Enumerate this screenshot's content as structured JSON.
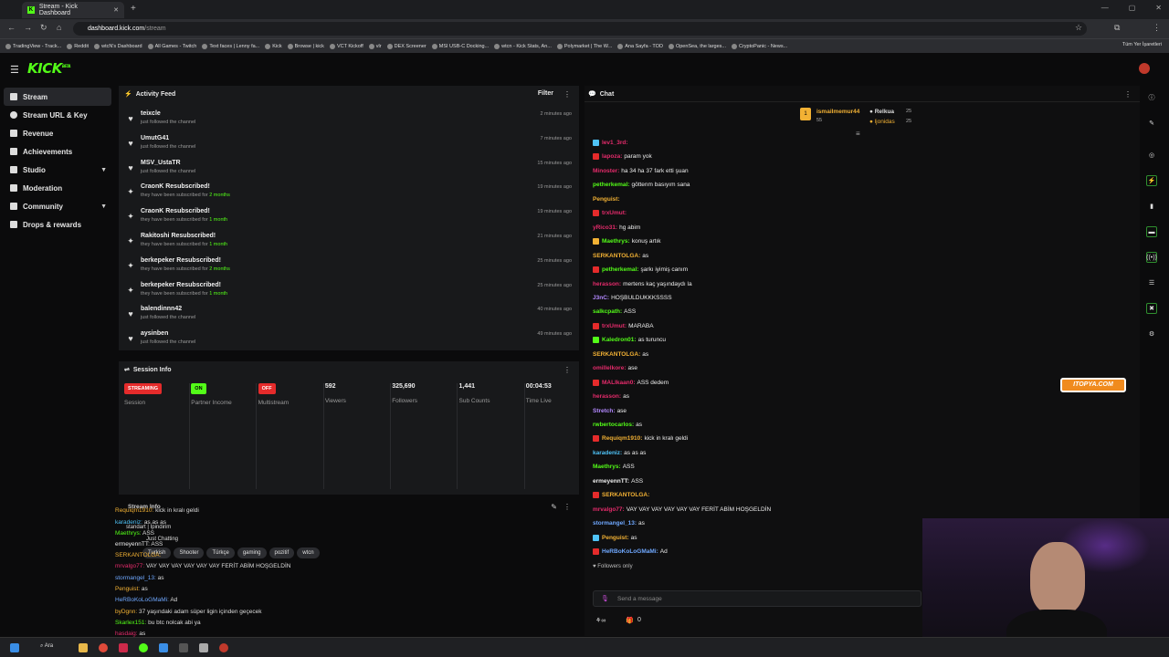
{
  "browser": {
    "tab_title": "Stream - Kick Dashboard",
    "url_host": "dashboard.kick.com",
    "url_path": "/stream",
    "bookmarks": [
      "TradingView - Track...",
      "Reddit",
      "wtcN's Dashboard",
      "All Games - Twitch",
      "Text faces | Lenny fa...",
      "Kick",
      "Browse | kick",
      "VCT Kickoff",
      "vlr",
      "DEX Screener",
      "MSI USB-C Docking...",
      "wtcn - Kick Stats, An...",
      "Polymarket | The W...",
      "Ana Sayfa - TOD",
      "OpenSea, the larges...",
      "CryptoPanic - News..."
    ],
    "all_bookmarks": "Tüm Yer İşaretleri"
  },
  "logo": "KICK",
  "logo_sup": "BETA",
  "sidebar": {
    "items": [
      {
        "label": "Stream"
      },
      {
        "label": "Stream URL & Key"
      },
      {
        "label": "Revenue"
      },
      {
        "label": "Achievements"
      },
      {
        "label": "Studio"
      },
      {
        "label": "Moderation"
      },
      {
        "label": "Community"
      },
      {
        "label": "Drops & rewards"
      }
    ]
  },
  "activity": {
    "title": "Activity Feed",
    "filter": "Filter",
    "items": [
      {
        "name": "teixcle",
        "sub": "just followed the channel",
        "time": "2 minutes ago"
      },
      {
        "name": "UmutG41",
        "sub": "just followed the channel",
        "time": "7 minutes ago"
      },
      {
        "name": "MSV_UstaTR",
        "sub": "just followed the channel",
        "time": "15 minutes ago"
      },
      {
        "name": "CraonK Resubscribed!",
        "sub": "they have been subscribed for",
        "dur": "2 months",
        "time": "19 minutes ago"
      },
      {
        "name": "CraonK Resubscribed!",
        "sub": "they have been subscribed for",
        "dur": "1 month",
        "time": "19 minutes ago"
      },
      {
        "name": "Rakitoshi Resubscribed!",
        "sub": "they have been subscribed for",
        "dur": "1 month",
        "time": "21 minutes ago"
      },
      {
        "name": "berkepeker Resubscribed!",
        "sub": "they have been subscribed for",
        "dur": "2 months",
        "time": "25 minutes ago"
      },
      {
        "name": "berkepeker Resubscribed!",
        "sub": "they have been subscribed for",
        "dur": "1 month",
        "time": "25 minutes ago"
      },
      {
        "name": "balendinnn42",
        "sub": "just followed the channel",
        "time": "40 minutes ago"
      },
      {
        "name": "aysinben",
        "sub": "just followed the channel",
        "time": "49 minutes ago"
      }
    ]
  },
  "session": {
    "title": "Session Info",
    "cols": [
      {
        "badge": "STREAMING",
        "badge_color": "#e52b2b",
        "label": "Session"
      },
      {
        "badge": "ON",
        "badge_color": "#53fc18",
        "label": "Partner Income"
      },
      {
        "badge": "OFF",
        "badge_color": "#e52b2b",
        "label": "Multistream"
      },
      {
        "value": "592",
        "label": "Viewers"
      },
      {
        "value": "325,690",
        "label": "Followers"
      },
      {
        "value": "1,441",
        "label": "Sub Counts"
      },
      {
        "value": "00:04:53",
        "label": "Time Live"
      }
    ]
  },
  "stream_info": {
    "title": "Stream Info",
    "stream_title": "standart | İpindirim",
    "category": "Just Chatting",
    "tags": [
      "Turkish",
      "Shooter",
      "Türkçe",
      "gaming",
      "pozitif",
      "wtcn"
    ]
  },
  "overlay_chat": [
    {
      "user": "Requiqm1910:",
      "msg": "kick in kralı geldi",
      "color": "#f2b134"
    },
    {
      "user": "karadeniz:",
      "msg": "as as as",
      "color": "#4fc3f7"
    },
    {
      "user": "Maethrys:",
      "msg": "ASS",
      "color": "#53fc18"
    },
    {
      "user": "ermeyennTT:",
      "msg": "ASS",
      "color": "#eee"
    },
    {
      "user": "SERKANTOLGA:",
      "msg": "",
      "color": "#f2b134"
    },
    {
      "user": "mrvalgo77:",
      "msg": "VAY VAY VAY VAY VAY VAY FERİT ABİM HOŞGELDİN",
      "color": "#e52b6b"
    },
    {
      "user": "stormangel_13:",
      "msg": "as",
      "color": "#6fa8ff"
    },
    {
      "user": "Penguist:",
      "msg": "as",
      "color": "#f2b134"
    },
    {
      "user": "HeRBoKoLoGMaMi:",
      "msg": "Ad",
      "color": "#6fa8ff"
    },
    {
      "user": "byDgnn:",
      "msg": "37 yaşındaki adam süper ligin içinden geçecek",
      "color": "#f2b134"
    },
    {
      "user": "Skarlex151:",
      "msg": "bu btc nolcak abi ya",
      "color": "#53fc18"
    },
    {
      "user": "hasdaig:",
      "msg": "as",
      "color": "#e52b6b"
    }
  ],
  "chat": {
    "title": "Chat",
    "top_gifters": [
      {
        "name": "ismailmemur44",
        "count": "55"
      },
      {
        "name": "Relkua",
        "count": "25"
      },
      {
        "name": "ljonidas",
        "count": "25"
      }
    ],
    "messages": [
      {
        "user": "lev1_3rd:",
        "msg": "",
        "color": "#e52b6b"
      },
      {
        "user": "lapoza:",
        "msg": "param yok",
        "color": "#e52b6b"
      },
      {
        "user": "Minoster:",
        "msg": "ha 34 ha 37 fark etti şuan",
        "color": "#e52b6b"
      },
      {
        "user": "petherkemal:",
        "msg": "göttenm basıyım sana",
        "color": "#53fc18"
      },
      {
        "user": "Penguist:",
        "msg": "",
        "color": "#f2b134"
      },
      {
        "user": "trxUmut:",
        "msg": "",
        "color": "#e52b6b"
      },
      {
        "user": "yRico31:",
        "msg": "hg abim",
        "color": "#e52b6b"
      },
      {
        "user": "Maethrys:",
        "msg": "konuş artık",
        "color": "#53fc18"
      },
      {
        "user": "SERKANTOLGA:",
        "msg": "as",
        "color": "#f2b134"
      },
      {
        "user": "petherkemal:",
        "msg": "şarkı iyimiş canım",
        "color": "#53fc18"
      },
      {
        "user": "herasson:",
        "msg": "mertens kaç yaşındaydı la",
        "color": "#e52b6b"
      },
      {
        "user": "J3nC:",
        "msg": "HOŞBULDUKKKSSSS",
        "color": "#b388ff"
      },
      {
        "user": "salkcpath:",
        "msg": "ASS",
        "color": "#53fc18"
      },
      {
        "user": "trxUmut:",
        "msg": "MARABA",
        "color": "#e52b6b"
      },
      {
        "user": "Kaledron01:",
        "msg": "as turuncu",
        "color": "#53fc18"
      },
      {
        "user": "SERKANTOLGA:",
        "msg": "as",
        "color": "#f2b134"
      },
      {
        "user": "omillelkore:",
        "msg": "ase",
        "color": "#e52b6b"
      },
      {
        "user": "MALIkaan0:",
        "msg": "ASS dedem",
        "color": "#e52b6b"
      },
      {
        "user": "herasson:",
        "msg": "as",
        "color": "#e52b6b"
      },
      {
        "user": "Stretch:",
        "msg": "ase",
        "color": "#b388ff"
      },
      {
        "user": "rwbertocarlos:",
        "msg": "as",
        "color": "#53fc18"
      },
      {
        "user": "Requiqm1910:",
        "msg": "kick in kralı geldi",
        "color": "#f2b134"
      },
      {
        "user": "karadeniz:",
        "msg": "as as as",
        "color": "#4fc3f7"
      },
      {
        "user": "Maethrys:",
        "msg": "ASS",
        "color": "#53fc18"
      },
      {
        "user": "ermeyennTT:",
        "msg": "ASS",
        "color": "#eee"
      },
      {
        "user": "SERKANTOLGA:",
        "msg": "",
        "color": "#f2b134"
      },
      {
        "user": "mrvalgo77:",
        "msg": "VAY VAY VAY VAY VAY VAY FERİT ABİM HOŞGELDİN",
        "color": "#e52b6b"
      },
      {
        "user": "stormangel_13:",
        "msg": "as",
        "color": "#6fa8ff"
      },
      {
        "user": "Penguist:",
        "msg": "as",
        "color": "#f2b134"
      },
      {
        "user": "HeRBoKoLoGMaMi:",
        "msg": "Ad",
        "color": "#6fa8ff"
      }
    ],
    "followers_only": "Followers only",
    "input_placeholder": "Send a message",
    "points": "0"
  },
  "overlay_logo": "ITOPYA.COM",
  "taskbar": {
    "search": "Ara"
  }
}
